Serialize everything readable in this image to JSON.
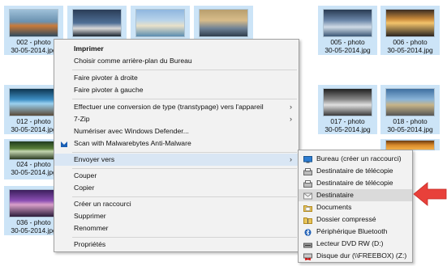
{
  "tiles": [
    {
      "id": "t1",
      "cap1": "002 - photo",
      "cap2": "30-05-2014.jpg",
      "thumb": "linear-gradient(180deg,#9ec0d8 0%,#6a91b0 45%,#c97a3a 60%,#2e4a5f 100%)"
    },
    {
      "id": "t2",
      "cap1": "",
      "cap2": "",
      "thumb": "linear-gradient(180deg,#2b3d57 0%,#4f6f96 50%,#d9d9d9 70%,#1a2430 100%)"
    },
    {
      "id": "t3",
      "cap1": "",
      "cap2": "",
      "thumb": "linear-gradient(180deg,#8fb7df 0%,#b8d3ea 40%,#e8e0c9 60%,#5b8db0 100%)"
    },
    {
      "id": "t4",
      "cap1": "",
      "cap2": "",
      "thumb": "linear-gradient(180deg,#b89f6e 0%,#d8bc8a 40%,#6f8296 70%,#2f3d4c 100%)"
    },
    {
      "id": "t5",
      "cap1": "005 - photo",
      "cap2": "30-05-2014.jpg",
      "thumb": "linear-gradient(180deg,#283a52 0%,#6b86a8 40%,#d0dbe6 65%,#3b5676 100%)"
    },
    {
      "id": "t6",
      "cap1": "006 - photo",
      "cap2": "30-05-2014.jpg",
      "thumb": "linear-gradient(180deg,#3a2c22 0%,#c98a3b 35%,#f2c36b 50%,#2a2420 100%)"
    },
    {
      "id": "t7",
      "cap1": "012 - photo",
      "cap2": "30-05-2014.jpg",
      "thumb": "linear-gradient(180deg,#0d3550 0%,#3e8fc4 40%,#9bd0ef 55%,#5a4a38 100%)"
    },
    {
      "id": "t8",
      "cap1": "017 - photo",
      "cap2": "30-05-2014.jpg",
      "thumb": "linear-gradient(180deg,#202020 0%,#8a8a8a 40%,#e0e0e0 60%,#3a3a3a 100%)"
    },
    {
      "id": "t9",
      "cap1": "018 - photo",
      "cap2": "30-05-2014.jpg",
      "thumb": "linear-gradient(180deg,#3e6fa0 0%,#8ab4d8 40%,#c7b488 60%,#555 100%)"
    },
    {
      "id": "t10",
      "cap1": "024 - photo",
      "cap2": "30-05-2014.jpg",
      "thumb": "linear-gradient(180deg,#1f3a1e 0%,#5a7f3a 40%,#c4d6b0 55%,#2b3b22 100%)"
    },
    {
      "id": "t11",
      "cap1": "036 - photo",
      "cap2": "30-05-2014.jpg",
      "thumb": "linear-gradient(180deg,#3b1f5c 0%,#8b4fb3 40%,#d9a0c9 55%,#2a1c3a 100%)"
    },
    {
      "id": "t12",
      "cap1": "",
      "cap2": "",
      "thumb": "linear-gradient(180deg,#6b3a10 0%,#d98a2a 50%,#f2b04a 100%)"
    }
  ],
  "context_menu": {
    "items": [
      {
        "label": "Imprimer",
        "bold": true
      },
      {
        "label": "Choisir comme arrière-plan du Bureau"
      },
      {
        "label": "Faire pivoter à droite"
      },
      {
        "label": "Faire pivoter à gauche"
      },
      {
        "label": "Effectuer une conversion de type (transtypage) vers l'appareil",
        "submenu": true
      },
      {
        "label": "7-Zip",
        "submenu": true
      },
      {
        "label": "Numériser avec Windows Defender..."
      },
      {
        "label": "Scan with Malwarebytes Anti-Malware",
        "icon": "malwarebytes-icon"
      },
      {
        "label": "Envoyer vers",
        "submenu": true,
        "highlighted": true
      },
      {
        "label": "Couper"
      },
      {
        "label": "Copier"
      },
      {
        "label": "Créer un raccourci"
      },
      {
        "label": "Supprimer"
      },
      {
        "label": "Renommer"
      },
      {
        "label": "Propriétés"
      }
    ],
    "submenu_arrow": "›"
  },
  "send_to_menu": {
    "items": [
      {
        "label": "Bureau (créer un raccourci)",
        "icon": "desktop-icon"
      },
      {
        "label": "Destinataire de télécopie",
        "icon": "fax-icon"
      },
      {
        "label": "Destinataire de télécopie",
        "icon": "fax-icon"
      },
      {
        "label": "Destinataire",
        "icon": "mail-envelope-icon",
        "highlighted": true
      },
      {
        "label": "Documents",
        "icon": "documents-folder-icon"
      },
      {
        "label": "Dossier compressé",
        "icon": "zip-folder-icon"
      },
      {
        "label": "Périphérique Bluetooth",
        "icon": "bluetooth-icon"
      },
      {
        "label": "Lecteur DVD RW (D:)",
        "icon": "dvd-drive-icon"
      },
      {
        "label": "Disque dur (\\\\FREEBOX) (Z:)",
        "icon": "network-drive-icon"
      }
    ]
  },
  "colors": {
    "selection": "#cce4f7",
    "menu_bg": "#f2f2f2",
    "arrow": "#e8403a"
  }
}
